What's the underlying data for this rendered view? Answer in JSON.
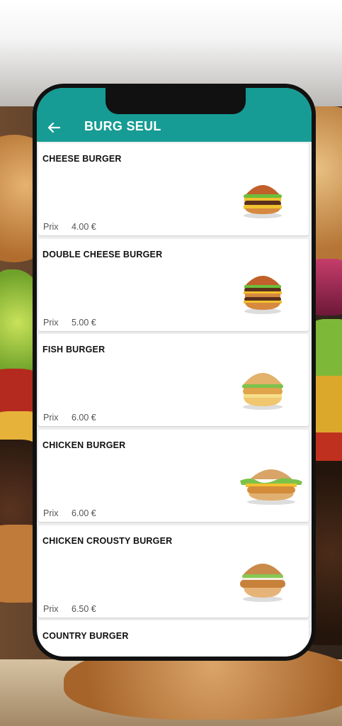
{
  "header": {
    "title": "BURG SEUL",
    "back_icon": "arrow-left-icon"
  },
  "colors": {
    "appbar": "#169c94",
    "card": "#ffffff"
  },
  "products": [
    {
      "name": "CHEESE BURGER",
      "price_label": "Prix",
      "price": "4.00 €",
      "image": "cheese-burger-image"
    },
    {
      "name": "DOUBLE CHEESE BURGER",
      "price_label": "Prix",
      "price": "5.00 €",
      "image": "double-cheese-burger-image"
    },
    {
      "name": "FISH BURGER",
      "price_label": "Prix",
      "price": "6.00 €",
      "image": "fish-burger-image"
    },
    {
      "name": "CHICKEN BURGER",
      "price_label": "Prix",
      "price": "6.00 €",
      "image": "chicken-burger-image"
    },
    {
      "name": "CHICKEN CROUSTY BURGER",
      "price_label": "Prix",
      "price": "6.50 €",
      "image": "chicken-crousty-burger-image"
    },
    {
      "name": "COUNTRY BURGER"
    }
  ]
}
